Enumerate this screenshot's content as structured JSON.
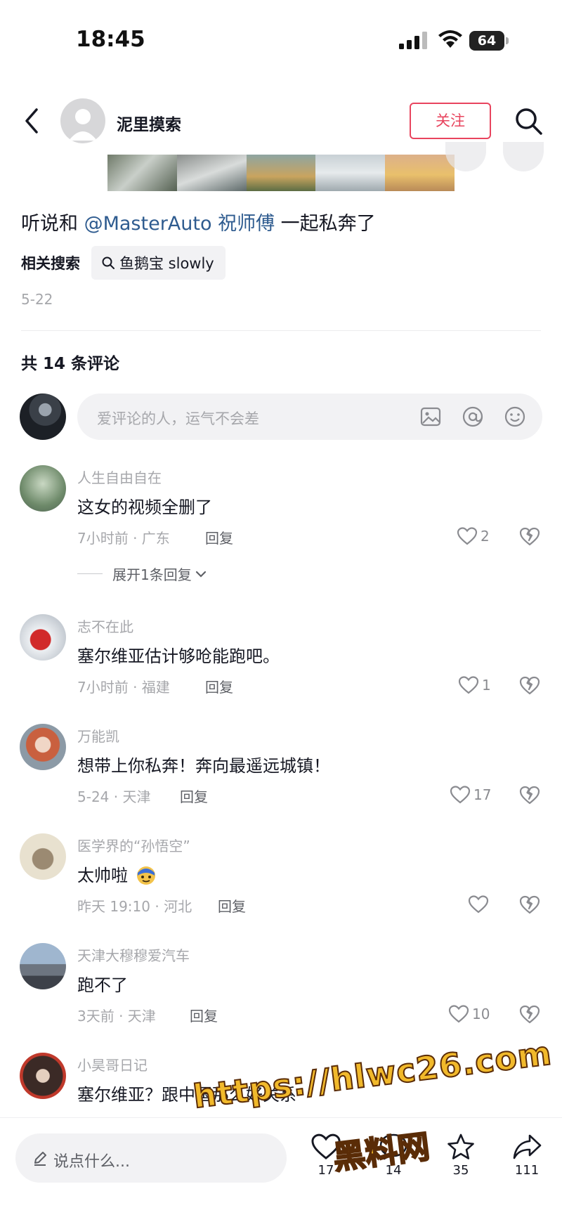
{
  "status_bar": {
    "time": "18:45",
    "battery": "64"
  },
  "header": {
    "author_name": "泥里摸索",
    "follow_label": "关注"
  },
  "post": {
    "caption_prefix": "听说和 ",
    "caption_mention": "@MasterAuto 祝师傅",
    "caption_suffix": " 一起私奔了",
    "related_label": "相关搜索",
    "related_query": "鱼鹅宝 slowly",
    "date": "5-22"
  },
  "comments_header": {
    "count_label": "共 14 条评论"
  },
  "composer": {
    "placeholder": "爱评论的人，运气不会差"
  },
  "reply_label": "回复",
  "comments": [
    {
      "user": "人生自由自在",
      "text": "这女的视频全删了",
      "meta": "7小时前 · 广东",
      "likes": "2",
      "expand": "展开1条回复"
    },
    {
      "user": "志不在此",
      "text": "塞尔维亚估计够呛能跑吧。",
      "meta": "7小时前 · 福建",
      "likes": "1"
    },
    {
      "user": "万能凯",
      "text": "想带上你私奔！奔向最遥远城镇！",
      "meta": "5-24 · 天津",
      "likes": "17"
    },
    {
      "user": "医学界的“孙悟空”",
      "text": "太帅啦",
      "meta": "昨天 19:10 · 河北",
      "likes": ""
    },
    {
      "user": "天津大穆穆爱汽车",
      "text": "跑不了",
      "meta": "3天前 · 天津",
      "likes": "10"
    },
    {
      "user": "小昊哥日记",
      "text": "塞尔维亚？跟中国那么好关系"
    }
  ],
  "bottom_bar": {
    "say_placeholder": "说点什么...",
    "like_count": "17",
    "comment_count": "14",
    "favorite_count": "35",
    "share_count": "111"
  },
  "watermark": {
    "url": "https://hlwc26.com",
    "name": "黑料网"
  },
  "colors": {
    "accent": "#e8445e",
    "mention": "#2e5b8f",
    "muted": "#a6a7ab",
    "watermark": "#f1b92b"
  },
  "icons": [
    "back-icon",
    "search-icon",
    "image-icon",
    "at-icon",
    "emoji-icon",
    "heart-icon",
    "dislike-icon",
    "pen-icon",
    "comment-icon",
    "star-icon",
    "share-icon"
  ]
}
